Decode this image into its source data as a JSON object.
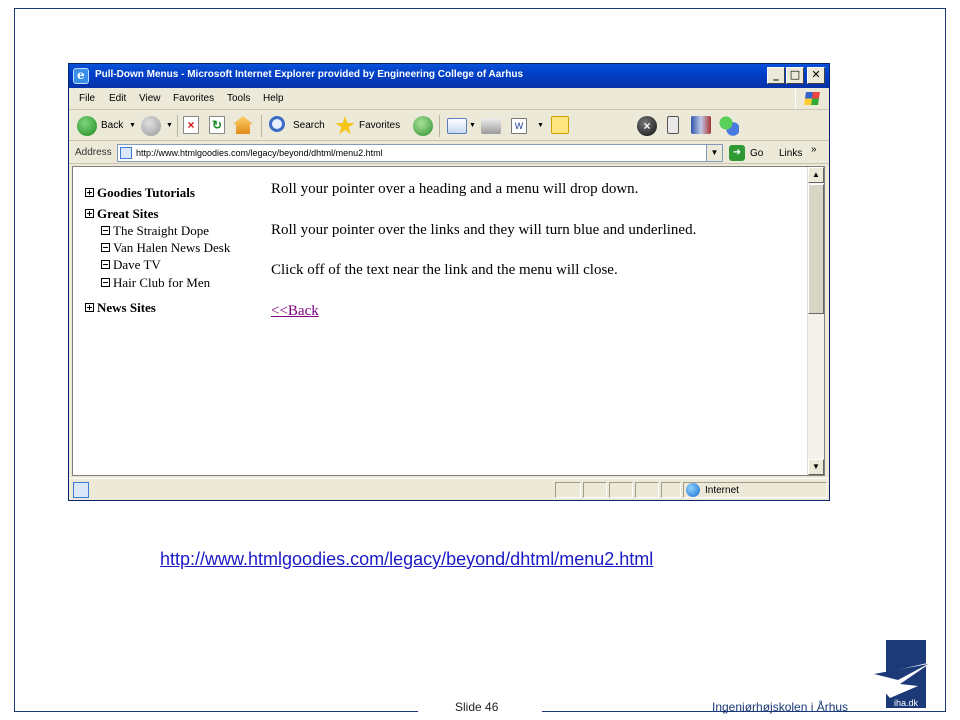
{
  "window": {
    "title": "Pull-Down Menus - Microsoft Internet Explorer provided by Engineering College of Aarhus",
    "buttons": [
      "_",
      "□",
      "✕"
    ]
  },
  "menubar": [
    "File",
    "Edit",
    "View",
    "Favorites",
    "Tools",
    "Help"
  ],
  "toolbar": {
    "back_label": "Back",
    "search_label": "Search",
    "favorites_label": "Favorites"
  },
  "address": {
    "label": "Address",
    "url": "http://www.htmlgoodies.com/legacy/beyond/dhtml/menu2.html",
    "go_label": "Go",
    "links_label": "Links",
    "chevron": "»"
  },
  "page": {
    "menu": {
      "goodies": "Goodies Tutorials",
      "great_sites": "Great Sites",
      "great_sites_items": [
        "The Straight Dope",
        "Van Halen News Desk",
        "Dave TV",
        "Hair Club for Men"
      ],
      "news_sites": "News Sites"
    },
    "paragraphs": [
      "Roll your pointer over a heading and a menu will drop down.",
      "Roll your pointer over the links and they will turn blue and underlined.",
      "Click off of the text near the link and the menu will close."
    ],
    "back_link": "<<Back"
  },
  "status": {
    "zone": "Internet"
  },
  "slide": {
    "link": "http://www.htmlgoodies.com/legacy/beyond/dhtml/menu2.html",
    "number": "Slide 46",
    "school": "Ingeniørhøjskolen i Århus",
    "logo_text": "iha.dk",
    "accent_color": "#1c3a78",
    "link_color": "#1a1ac8"
  }
}
